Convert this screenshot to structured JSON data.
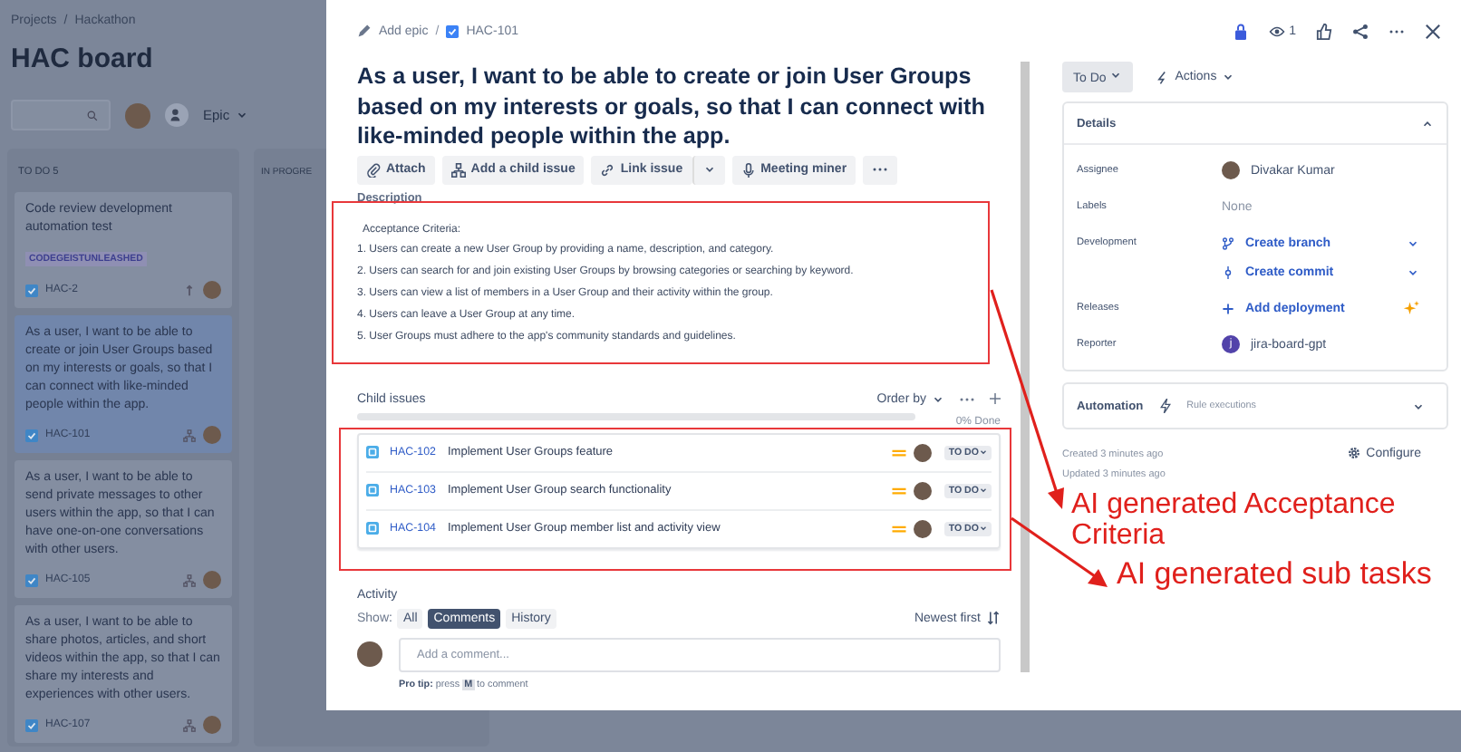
{
  "board": {
    "breadcrumb": [
      "Projects",
      "Hackathon"
    ],
    "separator": "/",
    "title": "HAC board",
    "filter": "Epic",
    "columns": [
      {
        "title": "TO DO 5",
        "cards": [
          {
            "summary": "Code review development automation test",
            "label": "CODEGEISTUNLEASHED",
            "key": "HAC-2",
            "kind": "priority",
            "selected": false
          },
          {
            "summary": "As a user, I want to be able to create or join User Groups based on my interests or goals, so that I can connect with like-minded people within the app.",
            "key": "HAC-101",
            "kind": "parent",
            "selected": true
          },
          {
            "summary": "As a user, I want to be able to send private messages to other users within the app, so that I can have one-on-one conversations with other users.",
            "key": "HAC-105",
            "kind": "parent",
            "selected": false
          },
          {
            "summary": "As a user, I want to be able to share photos, articles, and short videos within the app, so that I can share my interests and experiences with other users.",
            "key": "HAC-107",
            "kind": "parent",
            "selected": false
          }
        ]
      },
      {
        "title": "IN PROGRE"
      }
    ]
  },
  "issue": {
    "epic": "Add epic",
    "separator": "/",
    "key": "HAC-101",
    "watchers": "1",
    "title": "As a user, I want to be able to create or join User Groups based on my interests or goals, so that I can connect with like-minded people within the app.",
    "toolbar": [
      {
        "label": "Attach",
        "kind": "attach"
      },
      {
        "label": "Add a child issue",
        "kind": "child"
      },
      {
        "label": "Link issue",
        "kind": "link"
      },
      {
        "label": "Meeting miner",
        "kind": "mic"
      }
    ],
    "description": {
      "heading": "Description",
      "lines": [
        "Acceptance Criteria:",
        "1. Users can create a new User Group by providing a name, description, and category.",
        "2. Users can search for and join existing User Groups by browsing categories or searching by keyword.",
        "3. Users can view a list of members in a User Group and their activity within the group.",
        "4. Users can leave a User Group at any time.",
        "5. User Groups must adhere to the app's community standards and guidelines."
      ]
    },
    "child_issues": {
      "heading": "Child issues",
      "order_by": "Order by",
      "level": 0,
      "progress": "0% Done",
      "items": [
        {
          "key": "HAC-102",
          "summary": "Implement User Groups feature",
          "status": "TO DO"
        },
        {
          "key": "HAC-103",
          "summary": "Implement User Group search functionality",
          "status": "TO DO"
        },
        {
          "key": "HAC-104",
          "summary": "Implement User Group member list and activity view",
          "status": "TO DO"
        }
      ]
    },
    "activity": {
      "heading": "Activity",
      "show": "Show:",
      "filters": [
        {
          "label": "All",
          "selected": false
        },
        {
          "label": "Comments",
          "selected": true
        },
        {
          "label": "History",
          "selected": false
        }
      ],
      "sort": "Newest first",
      "placeholder": "Add a comment...",
      "tip_label": "Pro tip:",
      "tip_before": "press",
      "tip_key": "M",
      "tip_after": "to comment"
    }
  },
  "side": {
    "status": "To Do",
    "actions": "Actions",
    "details": {
      "heading": "Details",
      "fields": [
        {
          "label": "Assignee",
          "kind": "person",
          "values": [
            "Divakar Kumar"
          ]
        },
        {
          "label": "Labels",
          "kind": "text",
          "values": [
            "None"
          ]
        },
        {
          "label": "Development",
          "kind": "dev",
          "values": [
            "Create branch",
            "Create commit"
          ]
        },
        {
          "label": "Releases",
          "kind": "release",
          "values": [
            "Add deployment"
          ]
        },
        {
          "label": "Reporter",
          "kind": "app",
          "initial": "j",
          "values": [
            "jira-board-gpt"
          ]
        }
      ]
    },
    "automation": {
      "heading": "Automation",
      "rule": "Rule executions"
    },
    "created": "Created 3 minutes ago",
    "updated": "Updated 3 minutes ago",
    "configure": "Configure"
  },
  "annotations": [
    {
      "text": "AI generated Acceptance Criteria"
    },
    {
      "text": "AI generated sub tasks"
    }
  ]
}
